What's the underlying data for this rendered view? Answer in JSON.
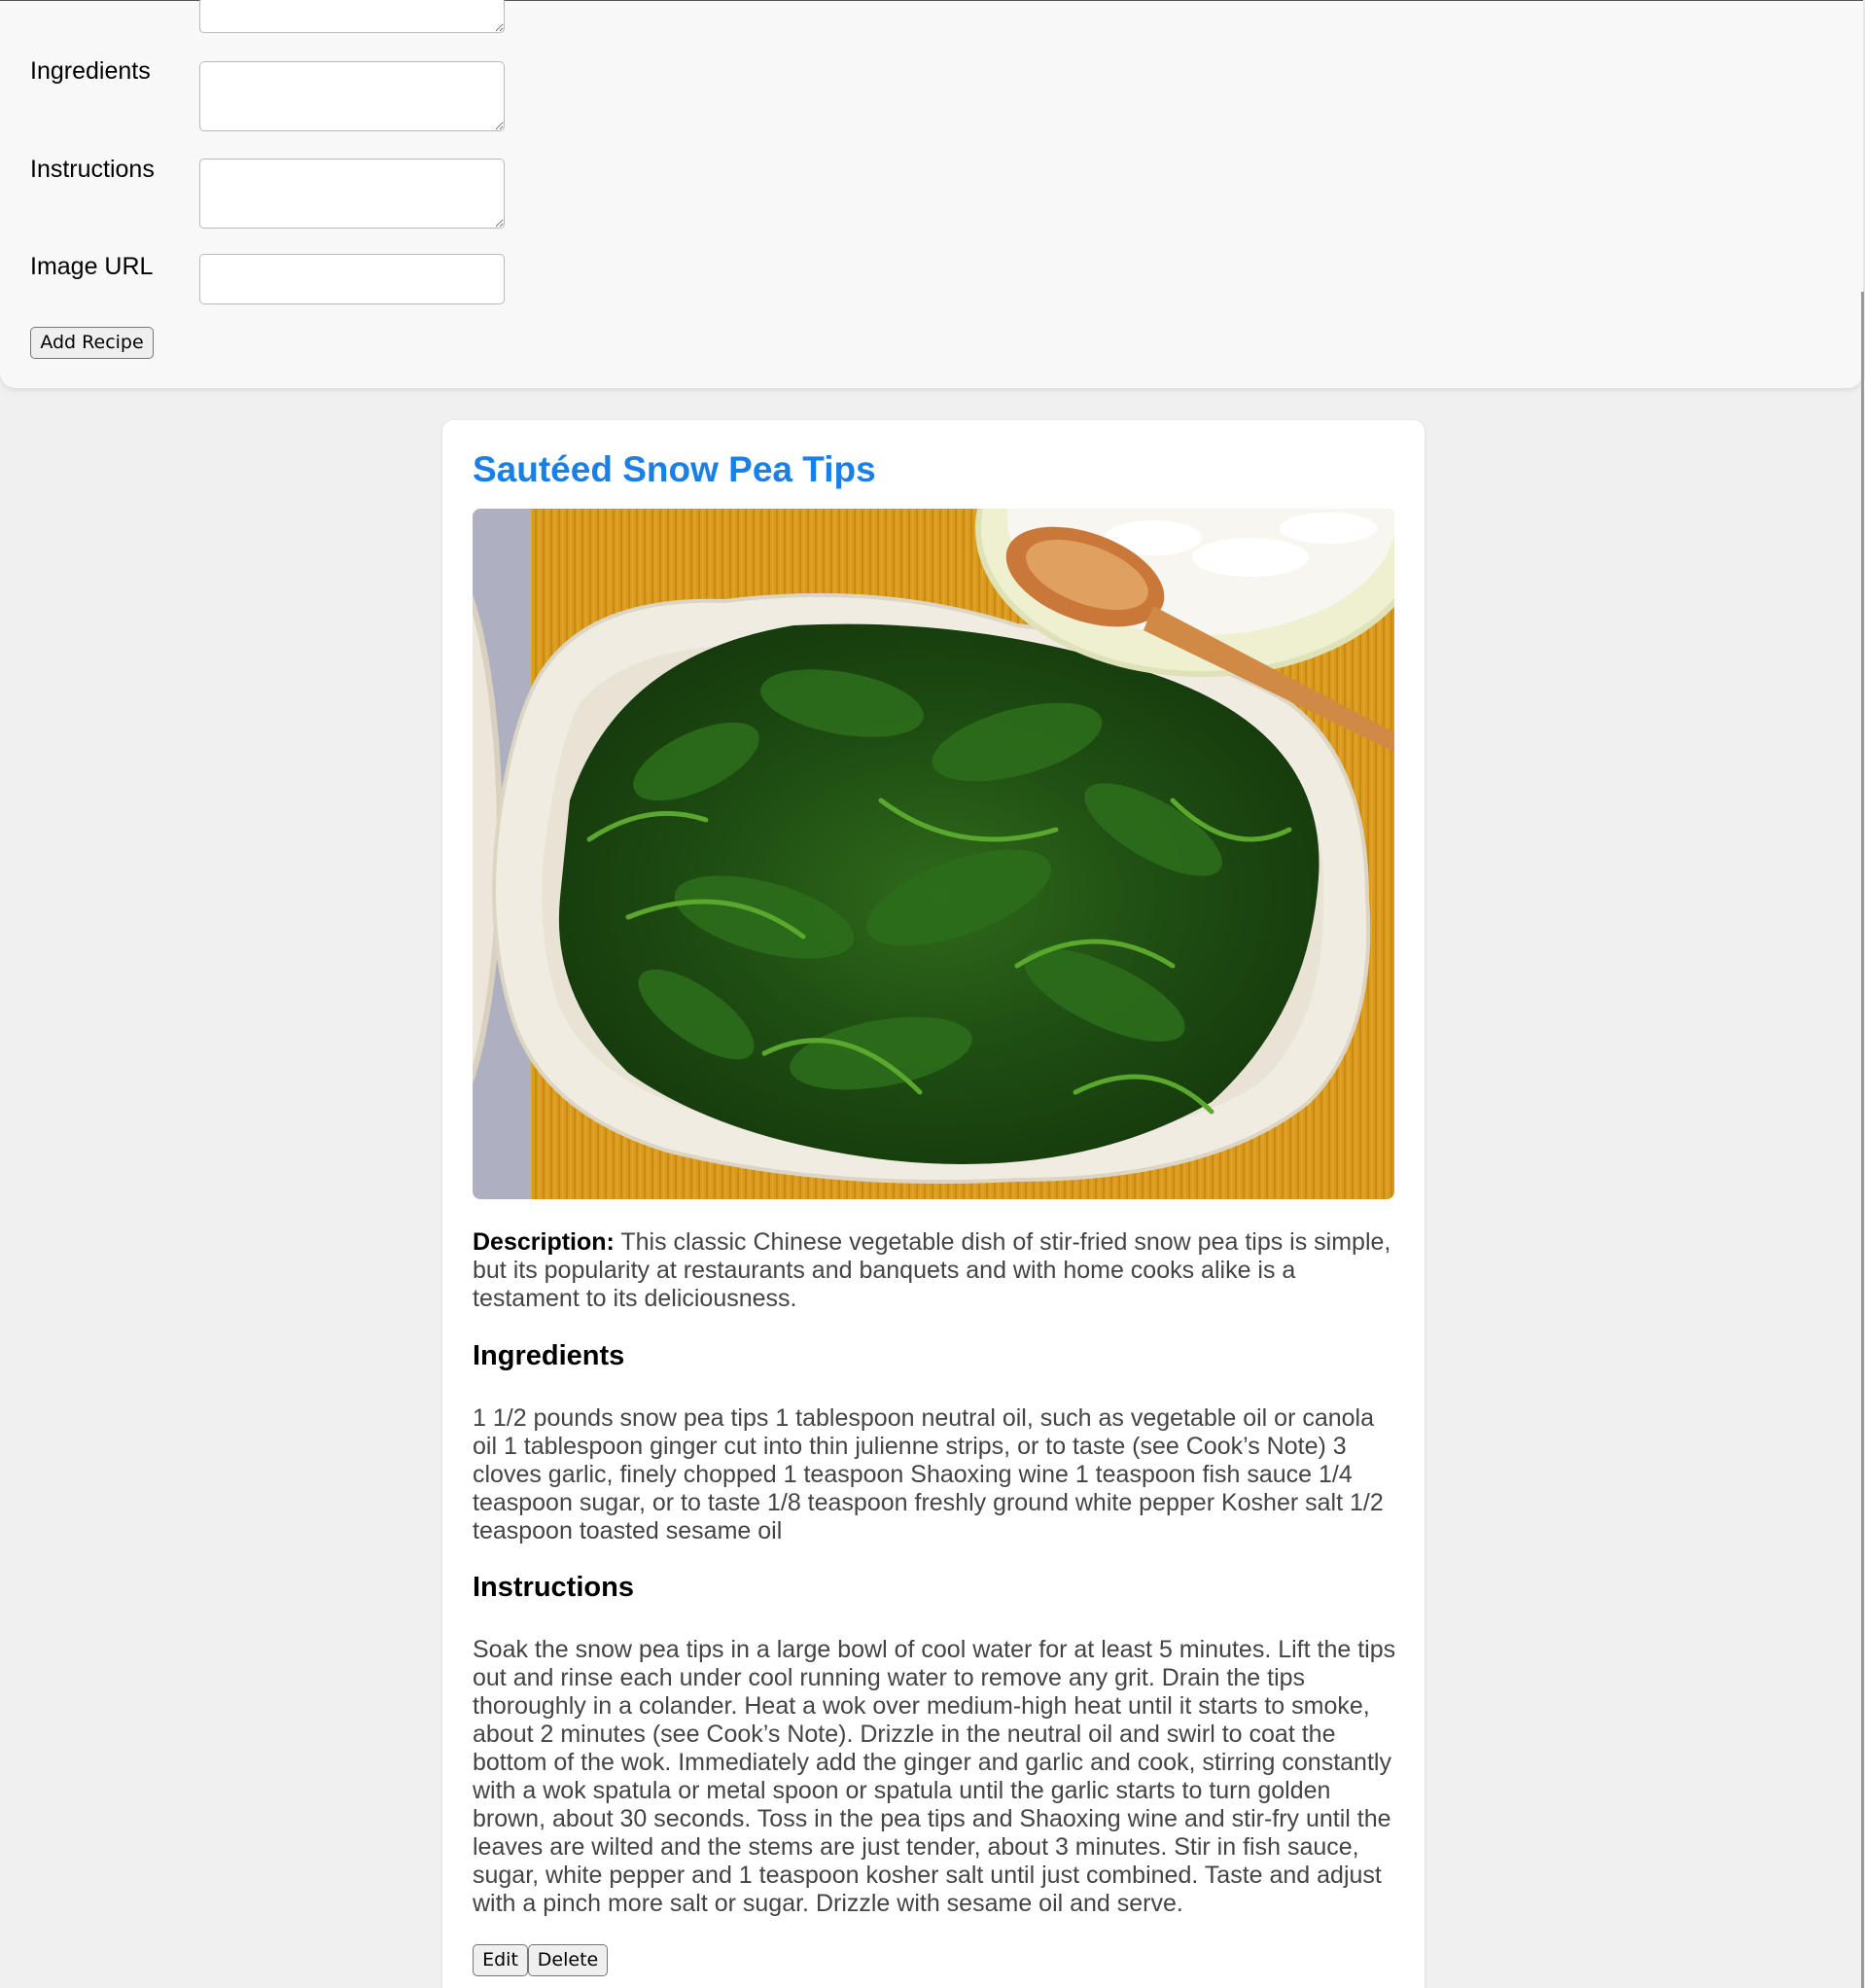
{
  "form": {
    "ingredients_label": "Ingredients",
    "ingredients_value": "",
    "instructions_label": "Instructions",
    "instructions_value": "",
    "image_url_label": "Image URL",
    "image_url_value": "",
    "add_button_label": "Add Recipe"
  },
  "recipe": {
    "title": "Sautéed Snow Pea Tips",
    "image_alt": "Plate of sautéed snow pea tips with a bowl of rice",
    "description_label": "Description:",
    "description": "This classic Chinese vegetable dish of stir-fried snow pea tips is simple, but its popularity at restaurants and banquets and with home cooks alike is a testament to its deliciousness.",
    "ingredients_heading": "Ingredients",
    "ingredients_text": "1 1/2 pounds snow pea tips 1 tablespoon neutral oil, such as vegetable oil or canola oil 1 tablespoon ginger cut into thin julienne strips, or to taste (see Cook’s Note) 3 cloves garlic, finely chopped 1 teaspoon Shaoxing wine 1 teaspoon fish sauce 1/4 teaspoon sugar, or to taste 1/8 teaspoon freshly ground white pepper Kosher salt 1/2 teaspoon toasted sesame oil",
    "instructions_heading": "Instructions",
    "instructions_text": "Soak the snow pea tips in a large bowl of cool water for at least 5 minutes. Lift the tips out and rinse each under cool running water to remove any grit. Drain the tips thoroughly in a colander. Heat a wok over medium-high heat until it starts to smoke, about 2 minutes (see Cook’s Note). Drizzle in the neutral oil and swirl to coat the bottom of the wok. Immediately add the ginger and garlic and cook, stirring constantly with a wok spatula or metal spoon or spatula until the garlic starts to turn golden brown, about 30 seconds. Toss in the pea tips and Shaoxing wine and stir-fry until the leaves are wilted and the stems are just tender, about 3 minutes. Stir in fish sauce, sugar, white pepper and 1 teaspoon kosher salt until just combined. Taste and adjust with a pinch more salt or sugar. Drizzle with sesame oil and serve.",
    "edit_label": "Edit",
    "delete_label": "Delete"
  },
  "colors": {
    "title_blue": "#1a7fe6",
    "page_bg": "#f0f0f0",
    "panel_bg": "#f8f8f8",
    "body_text": "#444444"
  }
}
